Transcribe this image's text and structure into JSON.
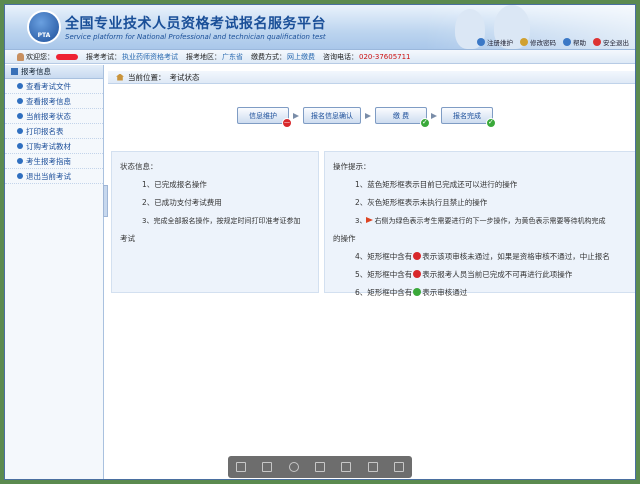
{
  "window": {
    "close_glyph": "x"
  },
  "header": {
    "logo_text": "PTA",
    "title": "全国专业技术人员资格考试报名服务平台",
    "subtitle": "Service platform for National Professional and technician qualification test",
    "links": [
      {
        "label": "注册维护",
        "icon": "user-edit-icon"
      },
      {
        "label": "修改密码",
        "icon": "key-icon"
      },
      {
        "label": "帮助",
        "icon": "help-icon"
      },
      {
        "label": "安全退出",
        "icon": "exit-icon"
      }
    ]
  },
  "infobar": {
    "welcome_label": "欢迎您：",
    "exam_label": "报考考试：",
    "exam_value": "执业药师资格考试",
    "region_label": "报考地区：",
    "region_value": "广东省",
    "pay_label": "缴费方式：",
    "pay_value": "网上缴费",
    "phone_label": "咨询电话：",
    "phone_value": "020-37605711"
  },
  "sidebar": {
    "title": "报考信息",
    "items": [
      {
        "label": "查看考试文件"
      },
      {
        "label": "查看报考信息"
      },
      {
        "label": "当前报考状态"
      },
      {
        "label": "打印报名表"
      },
      {
        "label": "订购考试教材"
      },
      {
        "label": "考生报考指南"
      },
      {
        "label": "退出当前考试"
      }
    ]
  },
  "breadcrumb": {
    "label": "当前位置：",
    "value": "考试状态"
  },
  "steps": [
    {
      "label": "信息维护",
      "status": "blocked"
    },
    {
      "label": "报名信息确认",
      "status": "none"
    },
    {
      "label": "缴 费",
      "status": "done"
    },
    {
      "label": "报名完成",
      "status": "done"
    }
  ],
  "status_panel": {
    "title": "状态信息：",
    "rows": [
      "1、已完成报名操作",
      "2、已成功支付考试费用",
      "3、完成全部报名操作，按规定时间打印准考证参加"
    ],
    "cont": "考试"
  },
  "tips_panel": {
    "title": "操作提示：",
    "rows": [
      "1、蓝色矩形框表示目前已完成还可以进行的操作",
      "2、灰色矩形框表示未执行且禁止的操作",
      "3、",
      "4、矩形框中含有",
      "5、矩形框中含有",
      "6、矩形框中含有"
    ],
    "row3_text": "右侧为绿色表示考生需要进行的下一步操作，为黄色表示需要等待机构完成",
    "row3_cont": "的操作",
    "row4_text": "表示该项审核未通过，如果是资格审核不通过，中止报名",
    "row5_text": "表示报考人员当前已完成不可再进行此项操作",
    "row6_text": "表示审核通过"
  },
  "colors": {
    "accent": "#1d4f9a",
    "red": "#d8282b",
    "green": "#3aa93a"
  }
}
